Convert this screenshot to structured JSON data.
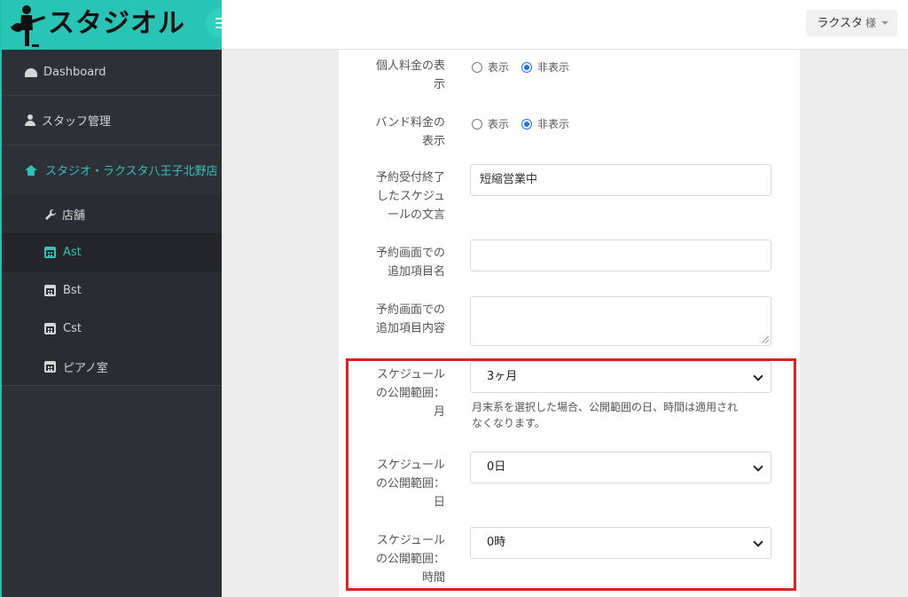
{
  "brand": {
    "logo_text": "スタジオル"
  },
  "topbar": {
    "user_name": "ラクスタ",
    "user_suffix": "様"
  },
  "sidebar": {
    "dashboard": "Dashboard",
    "staff": "スタッフ管理",
    "studio": "スタジオ・ラクスタ八王子北野店",
    "sub_items": [
      {
        "label": "店舗",
        "icon": "wrench-icon"
      },
      {
        "label": "Ast",
        "icon": "calendar-icon"
      },
      {
        "label": "Bst",
        "icon": "calendar-icon"
      },
      {
        "label": "Cst",
        "icon": "calendar-icon"
      },
      {
        "label": "ピアノ室",
        "icon": "calendar-icon"
      }
    ]
  },
  "form": {
    "personal_fee": {
      "label_1": "個人料金の表",
      "label_2": "示",
      "option_show": "表示",
      "option_hide": "非表示",
      "selected": "非表示"
    },
    "band_fee": {
      "label_1": "バンド料金の",
      "label_2": "表示",
      "option_show": "表示",
      "option_hide": "非表示",
      "selected": "非表示"
    },
    "closed_text": {
      "label_1": "予約受付終了",
      "label_2": "したスケジュ",
      "label_3": "ールの文言",
      "value": "短縮営業中"
    },
    "extra_item_name": {
      "label_1": "予約画面での",
      "label_2": "追加項目名",
      "value": ""
    },
    "extra_item_content": {
      "label_1": "予約画面での",
      "label_2": "追加項目内容",
      "value": ""
    },
    "range_month": {
      "label_1": "スケジュール",
      "label_2": "の公開範囲：",
      "label_3": "月",
      "value": "3ヶ月",
      "help_1": "月末系を選択した場合、公開範囲の日、時間は適用され",
      "help_2": "なくなります。"
    },
    "range_day": {
      "label_1": "スケジュール",
      "label_2": "の公開範囲：",
      "label_3": "日",
      "value": "0日"
    },
    "range_hour": {
      "label_1": "スケジュール",
      "label_2": "の公開範囲：",
      "label_3": "時間",
      "value": "0時"
    }
  },
  "colors": {
    "accent": "#28c4b6",
    "highlight": "#e02020",
    "sidebar": "#2e3038"
  }
}
